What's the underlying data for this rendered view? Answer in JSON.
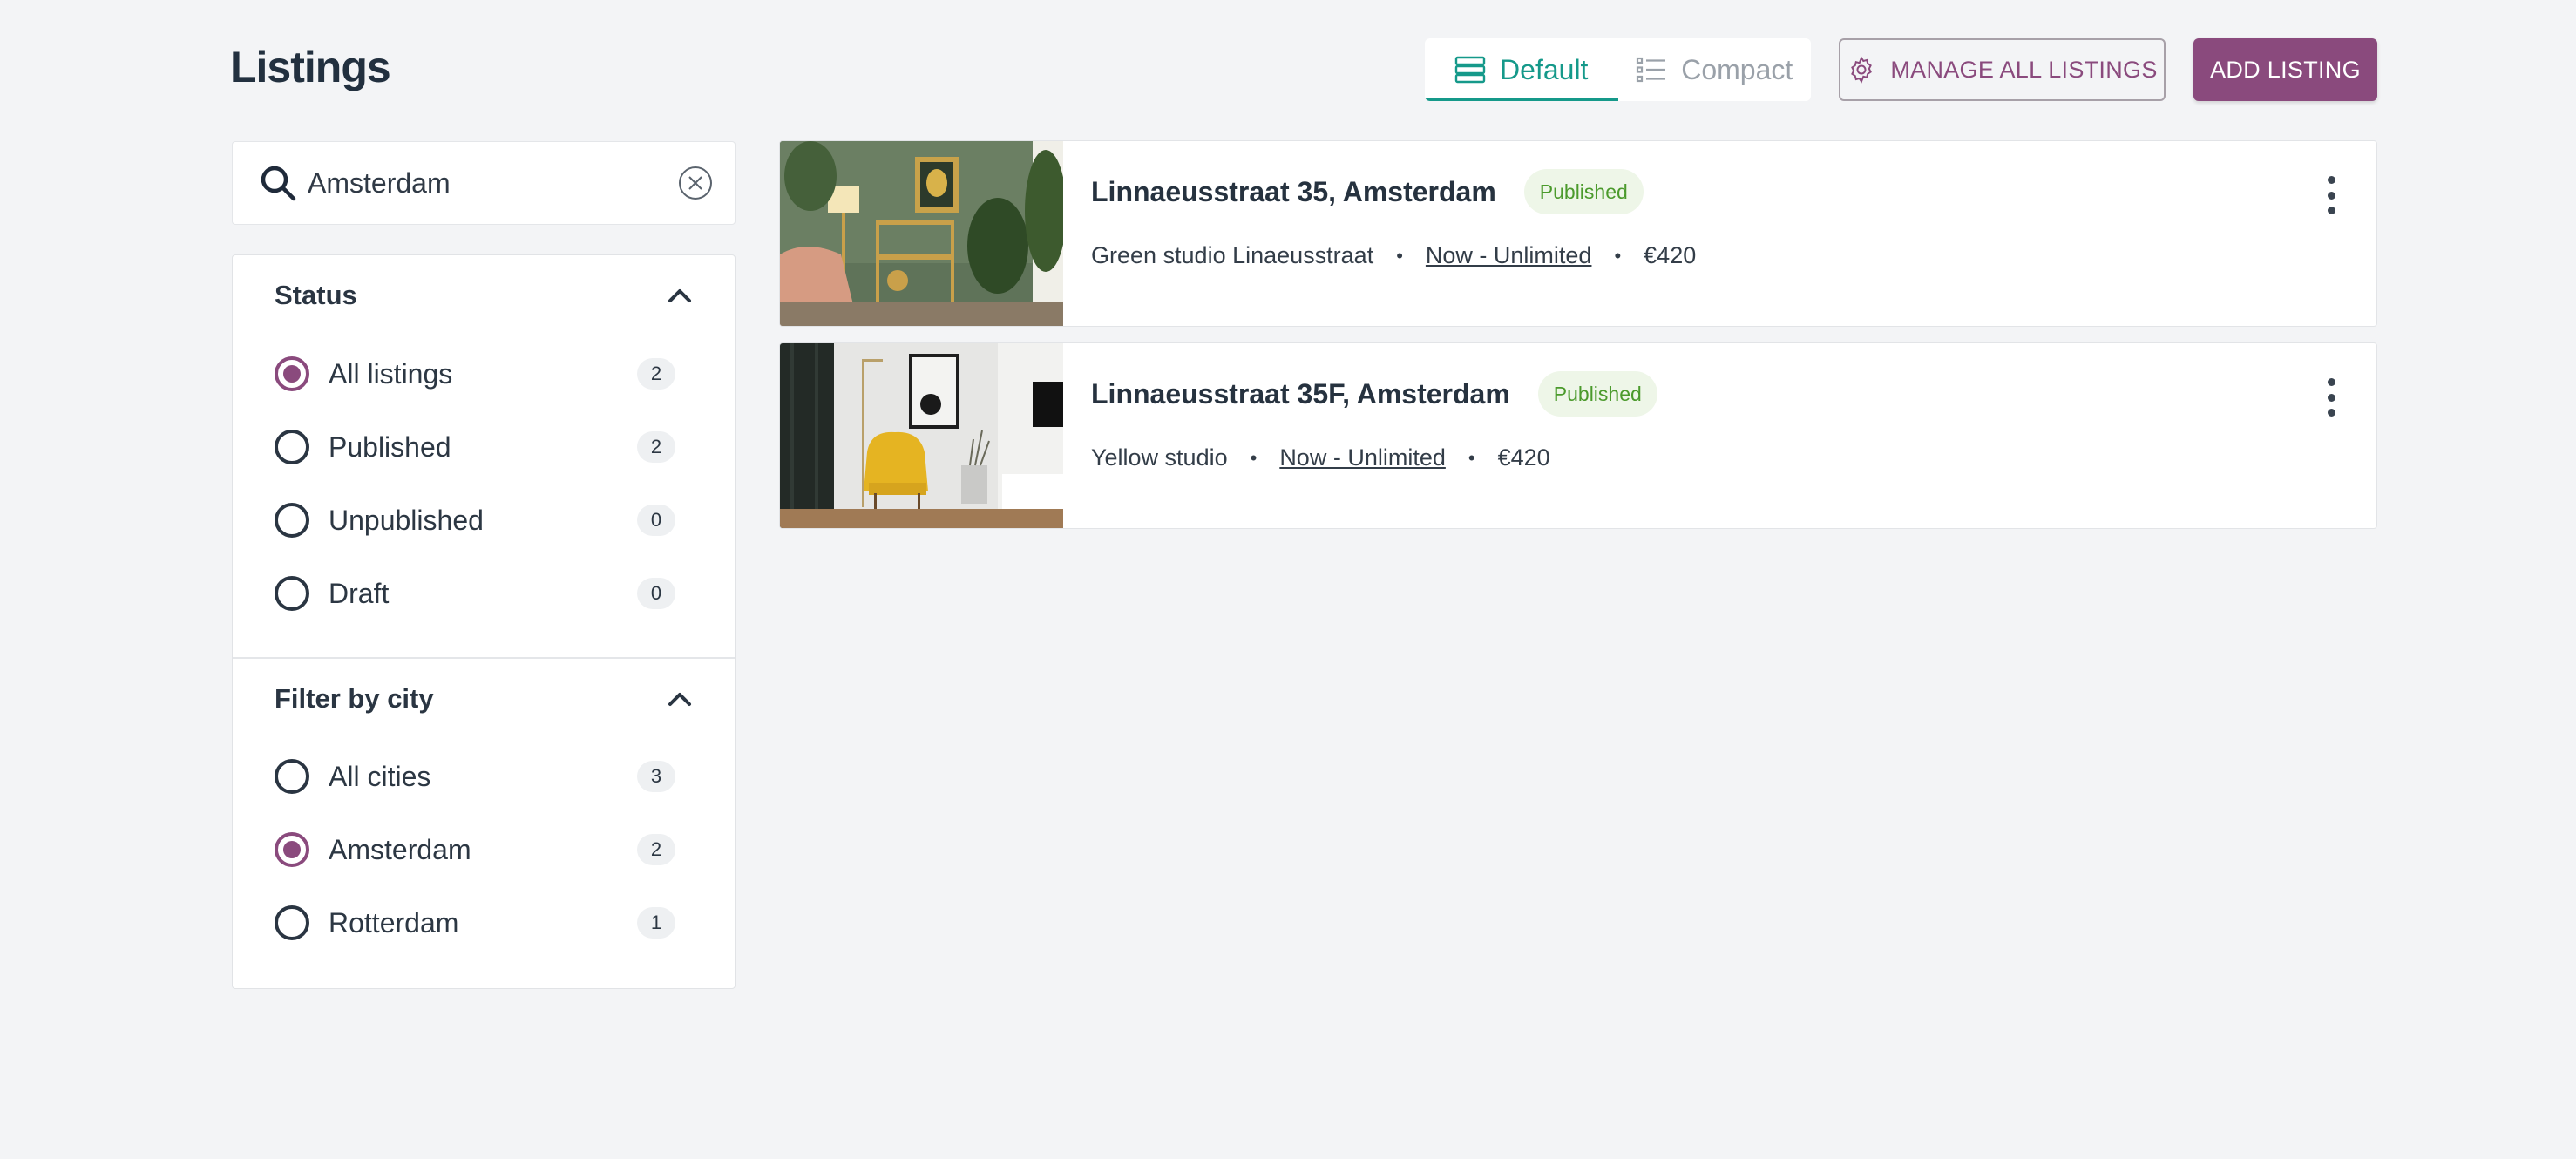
{
  "header": {
    "title": "Listings",
    "view_toggle": [
      {
        "label": "Default",
        "icon": "list-default-icon",
        "active": true
      },
      {
        "label": "Compact",
        "icon": "list-compact-icon",
        "active": false
      }
    ],
    "manage_label": "MANAGE ALL LISTINGS",
    "add_label": "ADD LISTING"
  },
  "search": {
    "value": "Amsterdam",
    "placeholder": "Search"
  },
  "filters": {
    "status": {
      "title": "Status",
      "options": [
        {
          "label": "All listings",
          "count": "2",
          "checked": true
        },
        {
          "label": "Published",
          "count": "2",
          "checked": false
        },
        {
          "label": "Unpublished",
          "count": "0",
          "checked": false
        },
        {
          "label": "Draft",
          "count": "0",
          "checked": false
        }
      ]
    },
    "city": {
      "title": "Filter by city",
      "options": [
        {
          "label": "All cities",
          "count": "3",
          "checked": false
        },
        {
          "label": "Amsterdam",
          "count": "2",
          "checked": true
        },
        {
          "label": "Rotterdam",
          "count": "1",
          "checked": false
        }
      ]
    }
  },
  "listings": [
    {
      "title": "Linnaeusstraat 35, Amsterdam",
      "status": "Published",
      "name": "Green studio Linaeusstraat",
      "availability": "Now - Unlimited",
      "price": "€420"
    },
    {
      "title": "Linnaeusstraat 35F, Amsterdam",
      "status": "Published",
      "name": "Yellow studio",
      "availability": "Now - Unlimited",
      "price": "€420"
    }
  ],
  "colors": {
    "brand": "#8a4a7d",
    "accent": "#15998a",
    "published_text": "#4b9a2c",
    "published_bg": "#eef6e8",
    "background": "#f3f4f6"
  }
}
